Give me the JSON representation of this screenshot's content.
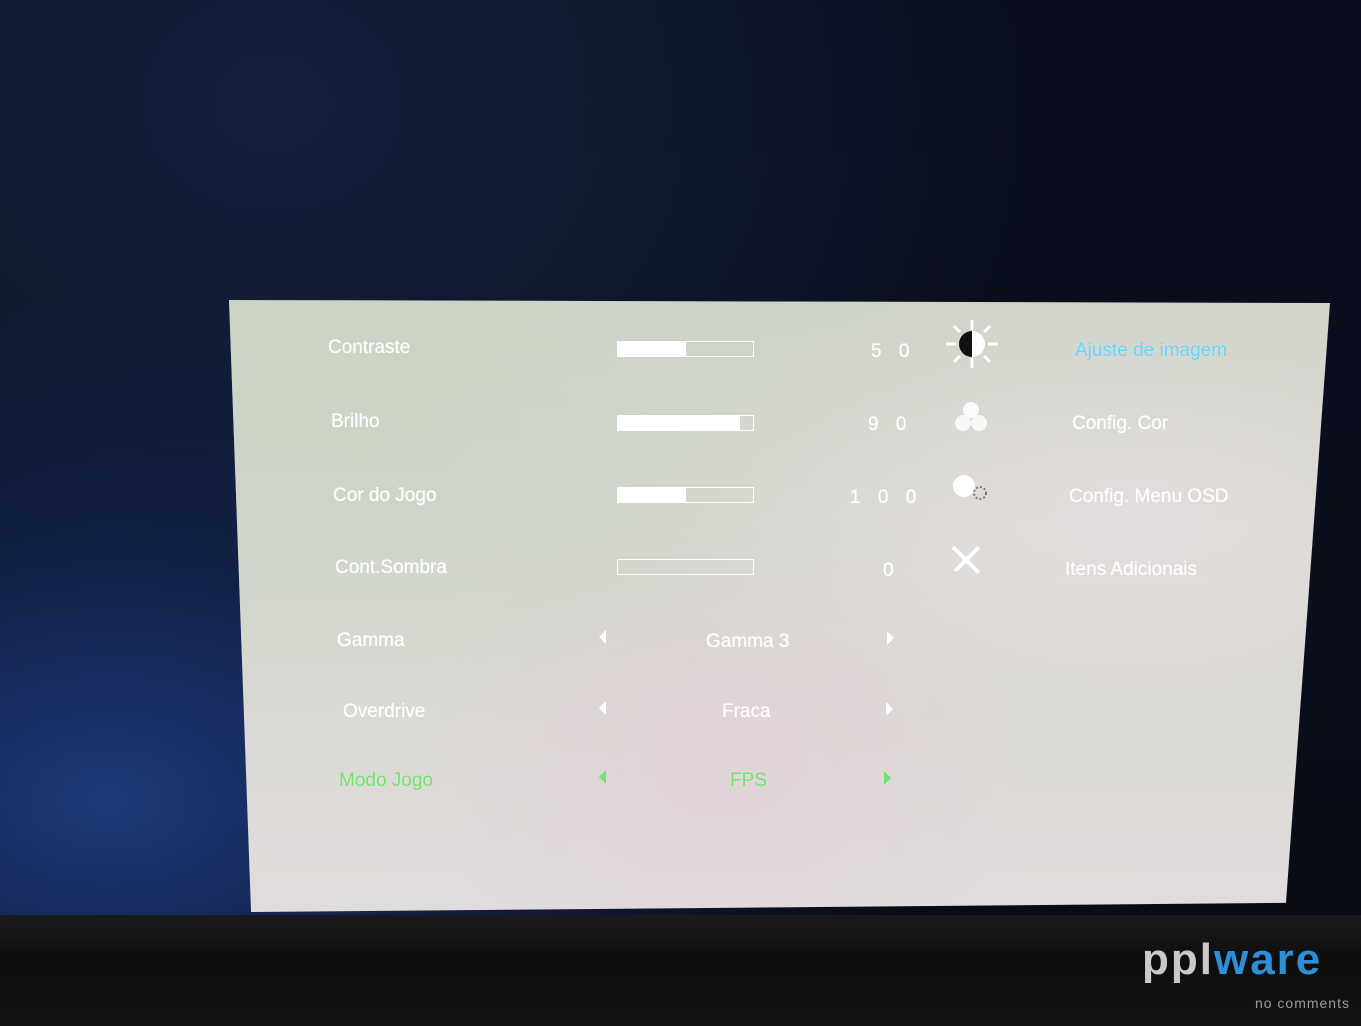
{
  "osd": {
    "rows": [
      {
        "label": "Contraste",
        "value": "5 0",
        "level": 0.5
      },
      {
        "label": "Brilho",
        "value": "9 0",
        "level": 0.9
      },
      {
        "label": "Cor do Jogo",
        "value": "1 0 0",
        "level": 0.5
      },
      {
        "label": "Cont.Sombra",
        "value": "0",
        "level": 0.0
      }
    ],
    "selectors": [
      {
        "label": "Gamma",
        "value": "Gamma 3"
      },
      {
        "label": "Overdrive",
        "value": "Fraca"
      },
      {
        "label": "Modo Jogo",
        "value": "FPS"
      }
    ],
    "menu": [
      {
        "label": "Ajuste de imagem",
        "icon": "brightness-contrast-icon",
        "selected": true
      },
      {
        "label": "Config. Cor",
        "icon": "color-circles-icon"
      },
      {
        "label": "Config. Menu OSD",
        "icon": "osd-settings-icon"
      },
      {
        "label": "Itens Adicionais",
        "icon": "tools-icon"
      }
    ],
    "colors": {
      "text": "#ffffff",
      "selected_row": "#6fe36a",
      "selected_menu": "#5fd6ff"
    }
  },
  "watermark": {
    "brand_a": "ppl",
    "brand_b": "ware",
    "tagline": "no comments"
  }
}
